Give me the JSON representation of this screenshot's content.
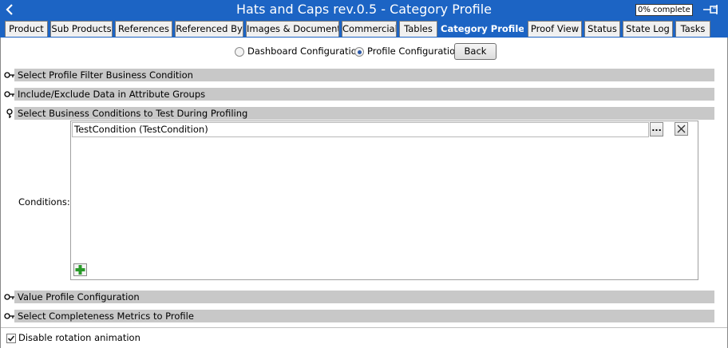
{
  "window": {
    "title": "Hats and Caps rev.0.5 - Category Profile",
    "progress_text": "0% complete"
  },
  "tabs": [
    {
      "label": "Product"
    },
    {
      "label": "Sub Products"
    },
    {
      "label": "References"
    },
    {
      "label": "Referenced By"
    },
    {
      "label": "Images & Documents"
    },
    {
      "label": "Commercial"
    },
    {
      "label": "Tables"
    },
    {
      "label": "Category Profile"
    },
    {
      "label": "Proof View"
    },
    {
      "label": "Status"
    },
    {
      "label": "State Log"
    },
    {
      "label": "Tasks"
    }
  ],
  "active_tab": "Category Profile",
  "mode": {
    "dashboard_label": "Dashboard Configuration",
    "profile_label": "Profile Configuration",
    "selected": "Profile Configuration",
    "back_label": "Back"
  },
  "sections": {
    "profile_filter": "Select Profile Filter Business Condition",
    "include_exclude": "Include/Exclude Data in Attribute Groups",
    "business_conditions": "Select Business Conditions to Test During Profiling",
    "value_profile": "Value Profile Configuration",
    "completeness": "Select Completeness Metrics to Profile"
  },
  "conditions": {
    "label": "Conditions:",
    "items": [
      "TestCondition (TestCondition)"
    ],
    "browse_label": "..."
  },
  "footer": {
    "disable_rotation_label": "Disable rotation animation",
    "disable_rotation_checked": true
  },
  "colors": {
    "accent": "#1c64c4",
    "section_bar": "#c8c8c8"
  }
}
